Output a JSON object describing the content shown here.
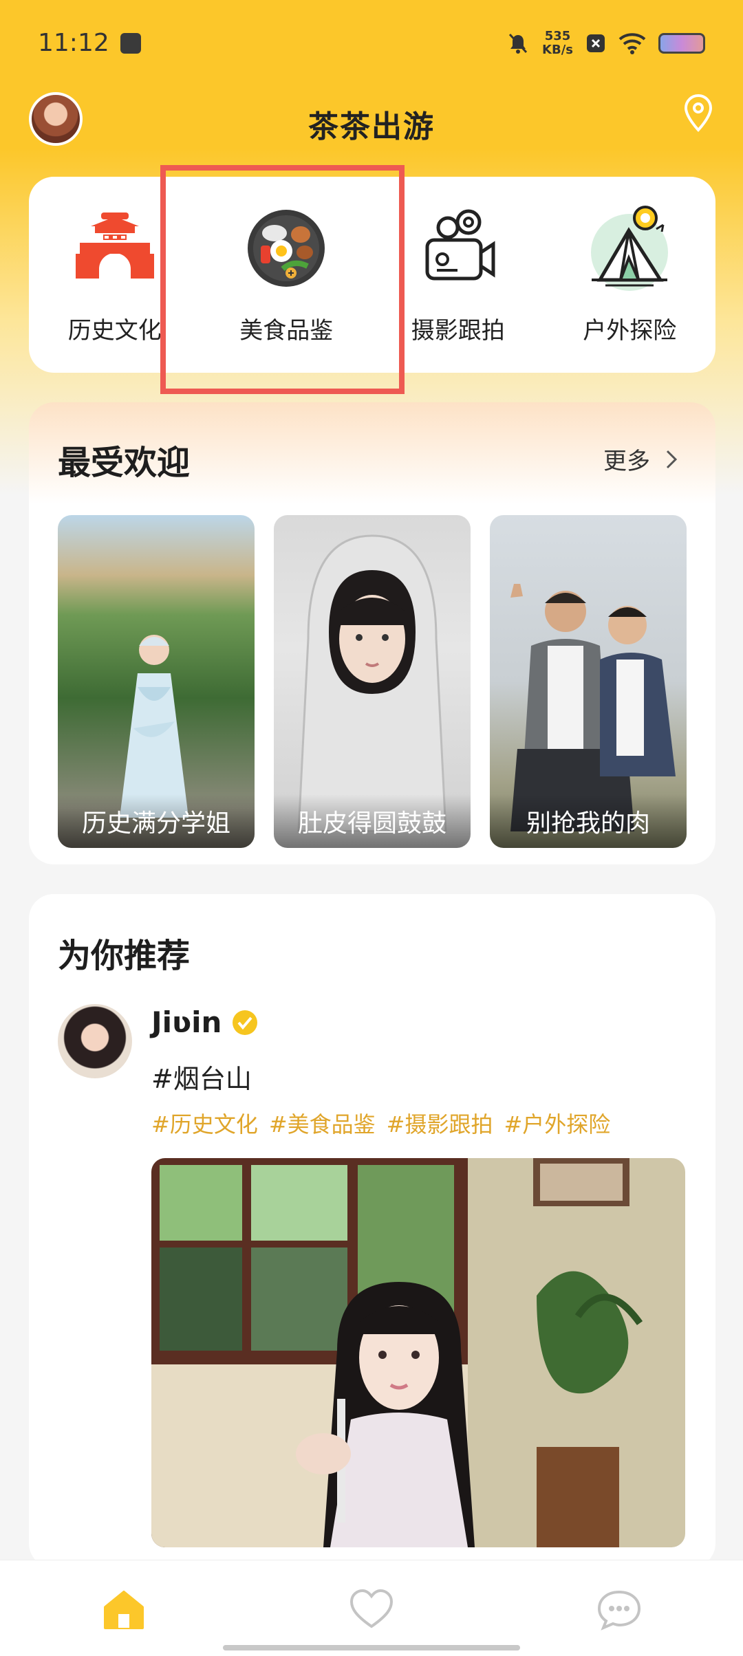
{
  "status_bar": {
    "time": "11:12",
    "net_speed_value": "535",
    "net_speed_unit": "KB/s"
  },
  "header": {
    "title": "茶茶出游"
  },
  "categories": [
    {
      "label": "历史文化",
      "icon": "chinese-gate-icon"
    },
    {
      "label": "美食品鉴",
      "icon": "food-plate-icon"
    },
    {
      "label": "摄影跟拍",
      "icon": "video-camera-icon"
    },
    {
      "label": "户外探险",
      "icon": "tent-icon"
    }
  ],
  "popular": {
    "title": "最受欢迎",
    "more_label": "更多",
    "items": [
      {
        "caption": "历史满分学姐"
      },
      {
        "caption": "肚皮得圆鼓鼓"
      },
      {
        "caption": "别抢我的肉"
      }
    ]
  },
  "recommend": {
    "title": "为你推荐",
    "post": {
      "author": "Jiʋin",
      "location_tag": "#烟台山",
      "tags": [
        "#历史文化",
        "#美食品鉴",
        "#摄影跟拍",
        "#户外探险"
      ]
    }
  },
  "bottom_nav": [
    {
      "icon": "home-icon",
      "active": true
    },
    {
      "icon": "heart-icon",
      "active": false
    },
    {
      "icon": "chat-icon",
      "active": false
    }
  ],
  "colors": {
    "brand": "#fcc72a",
    "tag": "#e0a52a",
    "highlight": "#ee5a52"
  }
}
